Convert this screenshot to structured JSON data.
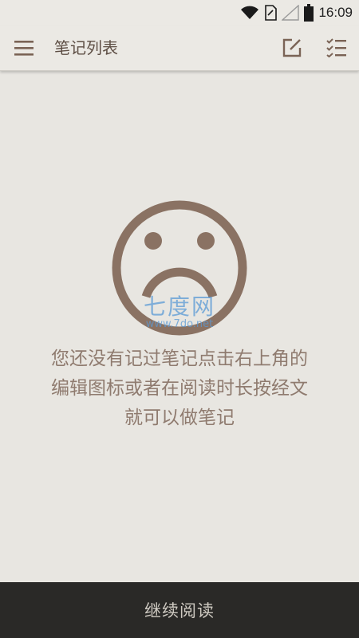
{
  "status_bar": {
    "time": "16:09",
    "icons": [
      "wifi-icon",
      "sim-card-icon",
      "signal-icon",
      "battery-icon"
    ]
  },
  "app_bar": {
    "title": "笔记列表",
    "icons": {
      "menu": "menu-icon",
      "edit": "edit-note-icon",
      "checklist": "checklist-icon"
    }
  },
  "empty_state": {
    "icon": "sad-face-icon",
    "message_lines": [
      "您还没有记过笔记点击右上角的",
      "编辑图标或者在阅读时长按经文",
      "就可以做笔记"
    ]
  },
  "watermark": {
    "title": "七度网",
    "url": "www.7do.net"
  },
  "bottom_bar": {
    "button_label": "继续阅读"
  },
  "colors": {
    "background": "#e8e6e1",
    "accent_brown": "#8a7263",
    "title_text": "#5d4e44",
    "message_text": "#8f7b6f",
    "bottom_bar_bg": "#2a2927",
    "bottom_bar_text": "#cfcac2",
    "watermark_blue": "#5b9ad6"
  }
}
